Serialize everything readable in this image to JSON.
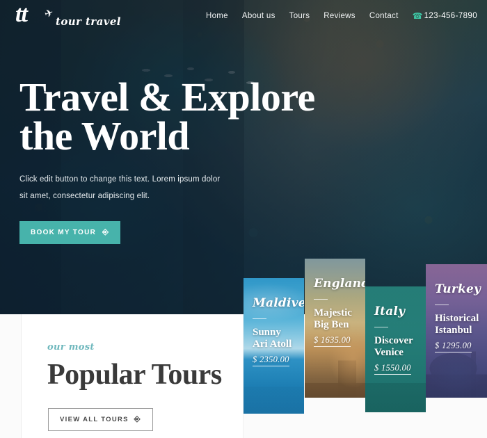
{
  "brand": {
    "mark": "tt",
    "plane_icon": "airplane-icon",
    "tagline": "tour travel"
  },
  "nav": {
    "items": [
      {
        "label": "Home"
      },
      {
        "label": "About us"
      },
      {
        "label": "Tours"
      },
      {
        "label": "Reviews"
      },
      {
        "label": "Contact"
      }
    ],
    "phone": {
      "icon": "phone-icon",
      "number": "123-456-7890",
      "icon_color": "#3ec9a7"
    }
  },
  "hero": {
    "title_line1": "Travel & Explore",
    "title_line2": "the World",
    "subtitle": "Click edit button to change this text. Lorem ipsum dolor sit amet, consectetur adipiscing elit.",
    "cta": {
      "label": "BOOK MY TOUR",
      "icon": "arrow-circle-right-icon",
      "background": "#47b3ab"
    }
  },
  "popular": {
    "eyebrow": "our most",
    "title": "Popular Tours",
    "eyebrow_color": "#6fb8bd",
    "cta": {
      "label": "VIEW ALL TOURS",
      "icon": "arrow-circle-right-icon"
    }
  },
  "tours": [
    {
      "country": "Maldives",
      "name": "Sunny Ari Atoll",
      "price": "$ 2350.00"
    },
    {
      "country": "England",
      "name": "Majestic Big Ben",
      "price": "$ 1635.00"
    },
    {
      "country": "Italy",
      "name": "Discover Venice",
      "price": "$ 1550.00"
    },
    {
      "country": "Turkey",
      "name": "Historical Istanbul",
      "price": "$ 1295.00"
    }
  ]
}
